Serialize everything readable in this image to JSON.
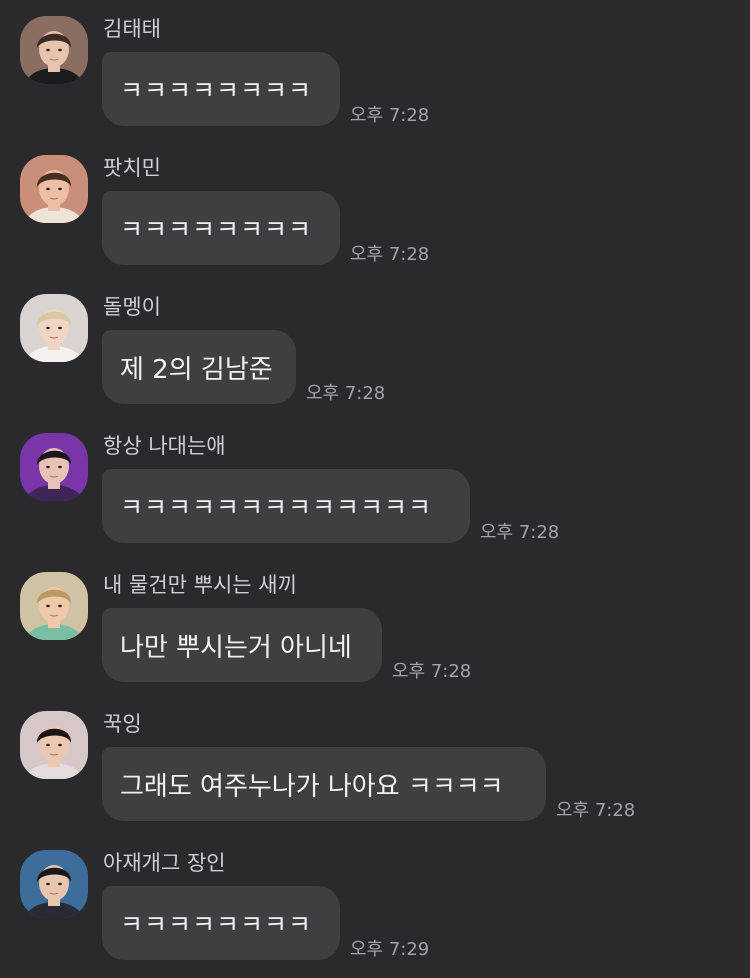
{
  "messages": [
    {
      "sender": "김태태",
      "text": "ㅋㅋㅋㅋㅋㅋㅋㅋ",
      "time": "오후 7:28",
      "avatar": {
        "bg": "#8a6e62",
        "hair": "#3a2b26",
        "skin": "#e8c4ae",
        "shirt": "#1c1c1c"
      }
    },
    {
      "sender": "팟치민",
      "text": "ㅋㅋㅋㅋㅋㅋㅋㅋ",
      "time": "오후 7:28",
      "avatar": {
        "bg": "#c98f7b",
        "hair": "#4a2e22",
        "skin": "#edc0a6",
        "shirt": "#f1e2d8"
      }
    },
    {
      "sender": "돌멩이",
      "text": "제 2의 김남준",
      "time": "오후 7:28",
      "avatar": {
        "bg": "#d8d4d0",
        "hair": "#d9c7a0",
        "skin": "#f0d5c2",
        "shirt": "#f4f1ee"
      }
    },
    {
      "sender": "항상 나대는애",
      "text": "ㅋㅋㅋㅋㅋㅋㅋㅋㅋㅋㅋㅋㅋ",
      "time": "오후 7:28",
      "avatar": {
        "bg": "#7a35a8",
        "hair": "#1e1520",
        "skin": "#e8c2b4",
        "shirt": "#3d2558"
      }
    },
    {
      "sender": "내 물건만 뿌시는 새끼",
      "text": "나만 뿌시는거 아니네",
      "time": "오후 7:28",
      "avatar": {
        "bg": "#cfc3a4",
        "hair": "#b89a62",
        "skin": "#efc9a8",
        "shirt": "#79bfa6"
      }
    },
    {
      "sender": "꾹잉",
      "text": "그래도 여주누나가 나아요 ㅋㅋㅋㅋ",
      "time": "오후 7:28",
      "avatar": {
        "bg": "#d6c8c8",
        "hair": "#1a1412",
        "skin": "#ecc8b0",
        "shirt": "#e4dcdc"
      }
    },
    {
      "sender": "아재개그 장인",
      "text": "ㅋㅋㅋㅋㅋㅋㅋㅋ",
      "time": "오후 7:29",
      "avatar": {
        "bg": "#3d6d9a",
        "hair": "#18181c",
        "skin": "#e8c6ad",
        "shirt": "#2a2a36"
      }
    }
  ]
}
